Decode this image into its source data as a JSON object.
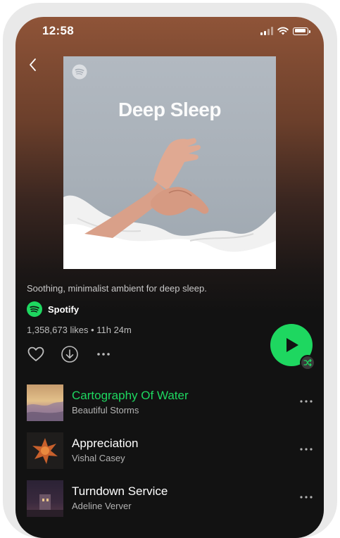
{
  "status_bar": {
    "time": "12:58"
  },
  "playlist": {
    "cover_title": "Deep Sleep",
    "description": "Soothing, minimalist ambient for deep sleep.",
    "owner": "Spotify",
    "stats": "1,358,673 likes • 11h 24m"
  },
  "tracks": [
    {
      "title": "Cartography Of Water",
      "artist": "Beautiful Storms",
      "playing": true
    },
    {
      "title": "Appreciation",
      "artist": "Vishal Casey",
      "playing": false
    },
    {
      "title": "Turndown Service",
      "artist": "Adeline Verver",
      "playing": false
    }
  ],
  "colors": {
    "accent": "#1ed760",
    "header_gradient_top": "#8f5438",
    "background": "#121212",
    "secondary_text": "#b3b3b3"
  },
  "icons": {
    "back": "chevron-left-icon",
    "like": "heart-icon",
    "download": "download-icon",
    "more": "ellipsis-icon",
    "play": "play-icon",
    "shuffle": "shuffle-icon"
  }
}
